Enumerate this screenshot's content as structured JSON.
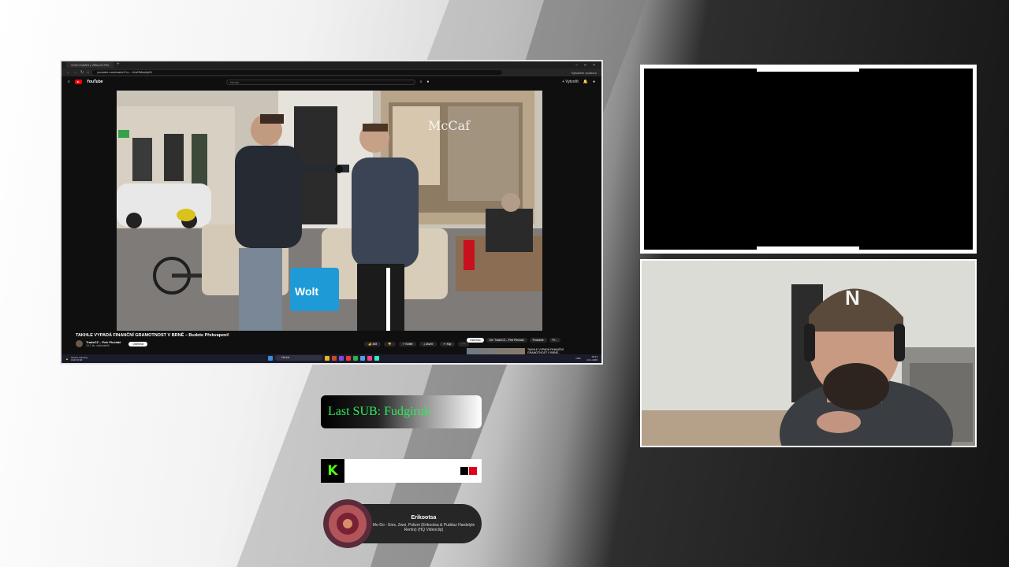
{
  "browser": {
    "tab_title": "VOICI DANS | VÍBLUŽ FIN",
    "url": "youtube.com/watch?v=...tUaOMaxfpA3",
    "winctl": [
      "–",
      "□",
      "×"
    ],
    "ext_label": "Vytváření souboru"
  },
  "youtube": {
    "logo_text": "YouTube",
    "search_placeholder": "Hledat",
    "create_label": "+ Vytvořit",
    "video_title": "TAKHLE VYPADÁ FINANČNÍ GRAMOTNOST V BRNĚ – Budete Překvapeni!",
    "channel_name": "TradeCZ – Petr Plecháč",
    "channel_subs": "10,1 tis. odběratelů",
    "subscribe_label": "Odebírat",
    "actions": [
      "👍 408",
      "👎",
      "↗ Sdílet",
      "⤓ Uložit",
      "✂ Klip",
      "···"
    ],
    "chips": [
      "Všechno",
      "Od: TradeCZ – Petr Plecháč",
      "Podobné",
      "Pr..."
    ],
    "rec_title": "TAKHLE VYPADÁ FINANČNÍ GRAMOTNOST V BRNĚ..."
  },
  "taskbar": {
    "warning_line1": "Severe warning",
    "warning_line2": "Until 10:00",
    "search_label": "Hledat",
    "time": "18:13",
    "date": "24.1.2025",
    "lang": "CES"
  },
  "widgets": {
    "last_sub": "Last SUB: Fudgiruk",
    "kick_letter": "K",
    "music_artist": "Erikootsa",
    "music_track": "Mo-Do - Eins, Zwei, Polizei (Erikootsa & Pudduz Hardstyle Remix) (HQ Videoclip)"
  },
  "colors": {
    "sub_text": "#2eea5b",
    "kick_green": "#53fc18",
    "kick_bar_black": "#000000",
    "kick_bar_red": "#e0001b"
  }
}
